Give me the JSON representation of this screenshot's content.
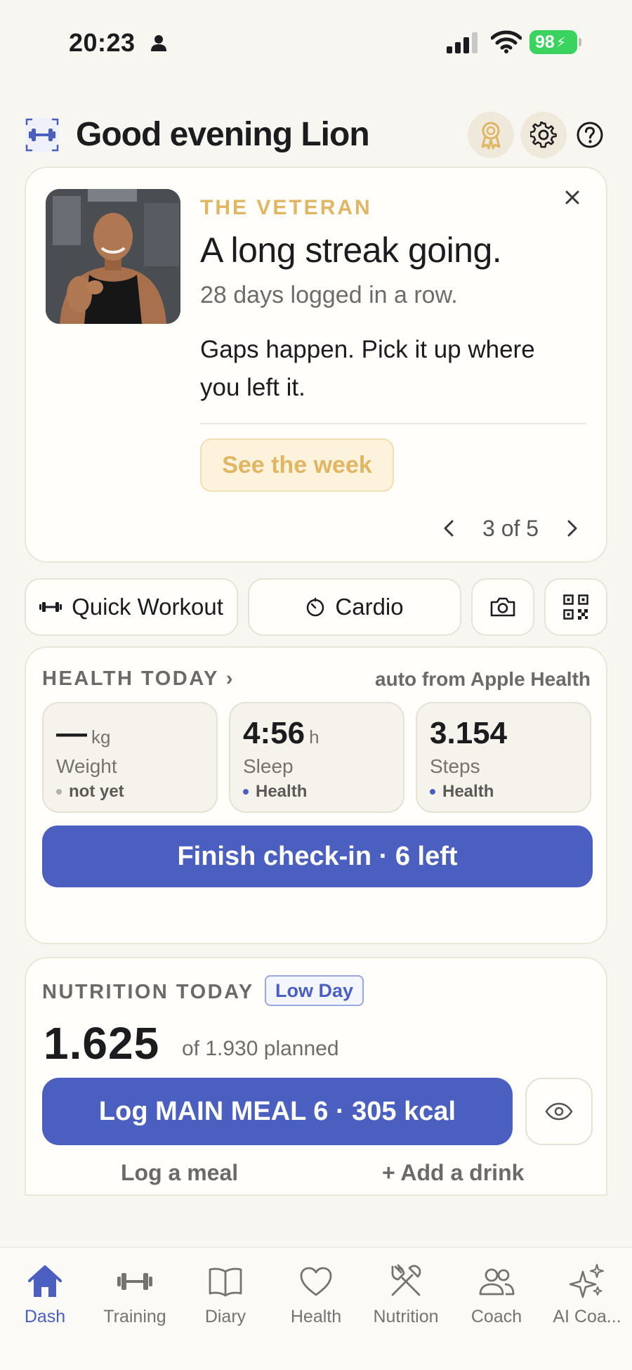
{
  "status_bar": {
    "time": "20:23",
    "battery": "98"
  },
  "header": {
    "greeting": "Good evening Lion"
  },
  "streak_card": {
    "eyebrow": "THE VETERAN",
    "title": "A long streak going.",
    "subtitle": "28 days logged in a row.",
    "body": "Gaps happen. Pick it up where you left it.",
    "cta": "See the week",
    "pager": "3 of 5"
  },
  "quick_actions": {
    "workout": "Quick Workout",
    "cardio": "Cardio"
  },
  "health_today": {
    "title": "HEALTH TODAY ›",
    "source_note": "auto from Apple Health",
    "metrics": [
      {
        "value": "—",
        "unit": "kg",
        "label": "Weight",
        "source": "not yet",
        "dot_color": "#b3b1ad"
      },
      {
        "value": "4:56",
        "unit": "h",
        "label": "Sleep",
        "source": "Health",
        "dot_color": "#4b5fc1"
      },
      {
        "value": "3.154",
        "unit": "",
        "label": "Steps",
        "source": "Health",
        "dot_color": "#4b5fc1"
      }
    ],
    "checkin_button": "Finish check-in · 6 left"
  },
  "nutrition_today": {
    "title": "NUTRITION TODAY",
    "badge": "Low Day",
    "kcal": "1.625",
    "planned": "of 1.930 planned",
    "log_button": "Log MAIN MEAL 6 · 305 kcal",
    "log_meal_link": "Log a meal",
    "add_drink_link": "+ Add a drink"
  },
  "tabs": [
    {
      "label": "Dash",
      "icon": "home-icon",
      "active": true
    },
    {
      "label": "Training",
      "icon": "dumbbell-icon"
    },
    {
      "label": "Diary",
      "icon": "book-icon"
    },
    {
      "label": "Health",
      "icon": "heart-icon"
    },
    {
      "label": "Nutrition",
      "icon": "utensils-icon"
    },
    {
      "label": "Coach",
      "icon": "people-icon"
    },
    {
      "label": "AI Coa...",
      "icon": "sparkles-icon"
    }
  ],
  "colors": {
    "accent": "#4b5fc1",
    "gold": "#e0b663",
    "background": "#f8f6f1",
    "battery": "#3bd35f"
  }
}
